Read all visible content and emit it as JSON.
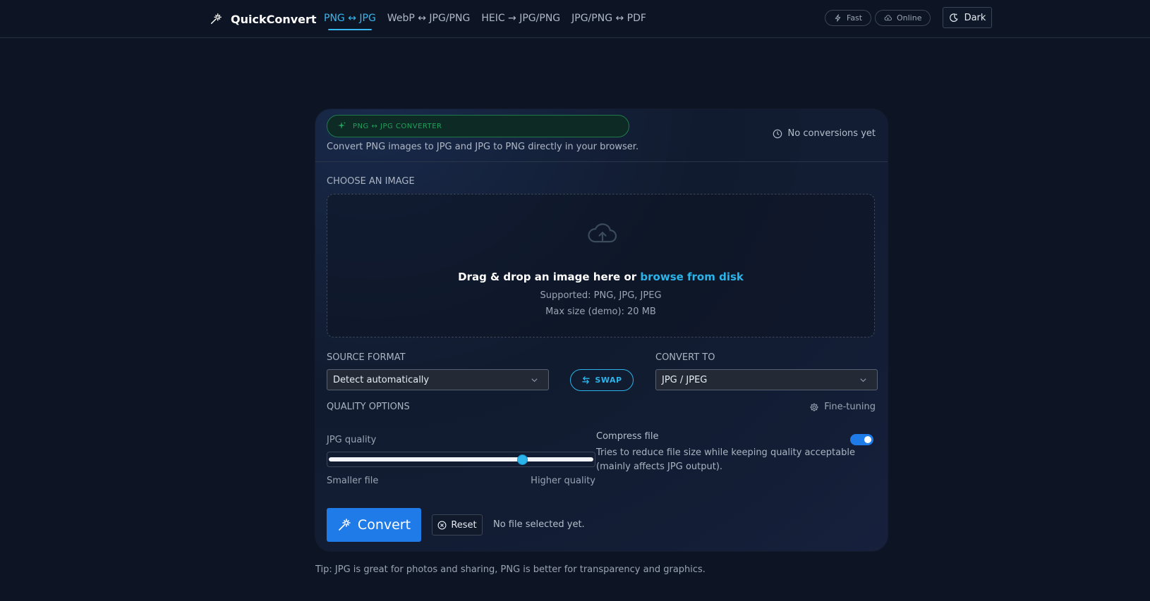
{
  "header": {
    "brand": "QuickConvert",
    "nav": [
      "PNG ↔ JPG",
      "WebP ↔ JPG/PNG",
      "HEIC → JPG/PNG",
      "JPG/PNG ↔ PDF"
    ],
    "pills": {
      "fast": "Fast",
      "online": "Online"
    },
    "theme_button": "Dark"
  },
  "card": {
    "badge": "PNG ↔ JPG CONVERTER",
    "subtitle": "Convert PNG images to JPG and JPG to PNG directly in your browser.",
    "history": "No conversions yet",
    "choose_label": "CHOOSE AN IMAGE",
    "dropzone": {
      "main": "Drag & drop an image here or ",
      "link": "browse from disk",
      "supported": "Supported: PNG, JPG, JPEG",
      "max_size": "Max size (demo): 20 MB"
    },
    "source_label": "SOURCE FORMAT",
    "source_value": "Detect automatically",
    "swap": "SWAP",
    "target_label": "CONVERT TO",
    "target_value": "JPG / JPEG",
    "quality_label": "QUALITY OPTIONS",
    "fine_tuning": "Fine-tuning",
    "jpg_quality_label": "JPG quality",
    "jpg_quality_level": 0.74,
    "slider_min_label": "Smaller file",
    "slider_max_label": "Higher quality",
    "compress_label": "Compress file",
    "compress_on": true,
    "compress_desc_1": "Tries to reduce file size while keeping quality acceptable",
    "compress_desc_2": "(mainly affects JPG output).",
    "convert": "Convert",
    "reset": "Reset",
    "status": "No file selected yet."
  },
  "tip": "Tip: JPG is great for photos and sharing, PNG is better for transparency and graphics.",
  "colors": {
    "accent": "#2bb4ea",
    "primary": "#1f7be8",
    "badge_green": "#23a05c",
    "background": "#0d1524"
  }
}
